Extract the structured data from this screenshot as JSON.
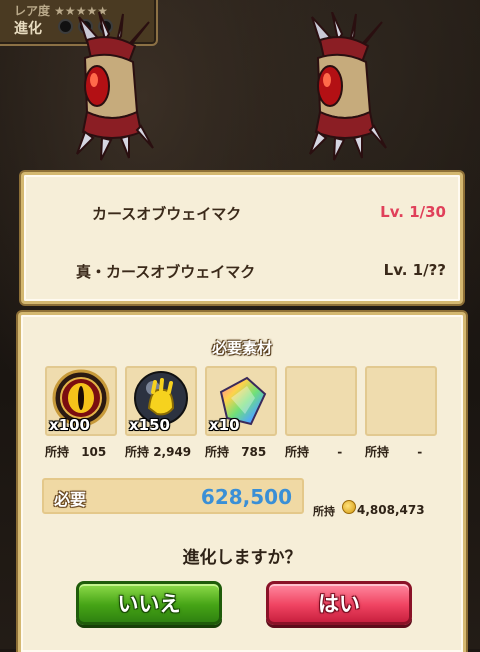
{
  "status": {
    "row1_label": "レア度  ★★★★★",
    "evolution_label": "進化",
    "evolution_dots": 3
  },
  "evolution": {
    "current": {
      "name": "カースオブウェイマク",
      "level": "Lv. 1/30"
    },
    "next": {
      "name": "真・カースオブウェイマク",
      "level": "Lv. 1/??"
    }
  },
  "materials": {
    "title": "必要素材",
    "items": [
      {
        "icon": "red-eye-seal-icon",
        "quantity": "x100",
        "owned_label": "所持",
        "owned_value": "105"
      },
      {
        "icon": "gold-claw-orb-icon",
        "quantity": "x150",
        "owned_label": "所持",
        "owned_value": "2,949"
      },
      {
        "icon": "rainbow-crystal-icon",
        "quantity": "x10",
        "owned_label": "所持",
        "owned_value": "785"
      },
      {
        "icon": "",
        "quantity": "",
        "owned_label": "所持",
        "owned_value": "-"
      },
      {
        "icon": "",
        "quantity": "",
        "owned_label": "所持",
        "owned_value": "-"
      }
    ]
  },
  "cost": {
    "label": "必要",
    "value": "628,500",
    "owned_label": "所持",
    "owned_value": "4,808,473"
  },
  "prompt": {
    "question": "進化しますか？",
    "no_label": "いいえ",
    "yes_label": "はい"
  },
  "colors": {
    "current_level": "#e0405a",
    "next_level": "#3b2a1a",
    "required_value": "#3a8fd6"
  }
}
